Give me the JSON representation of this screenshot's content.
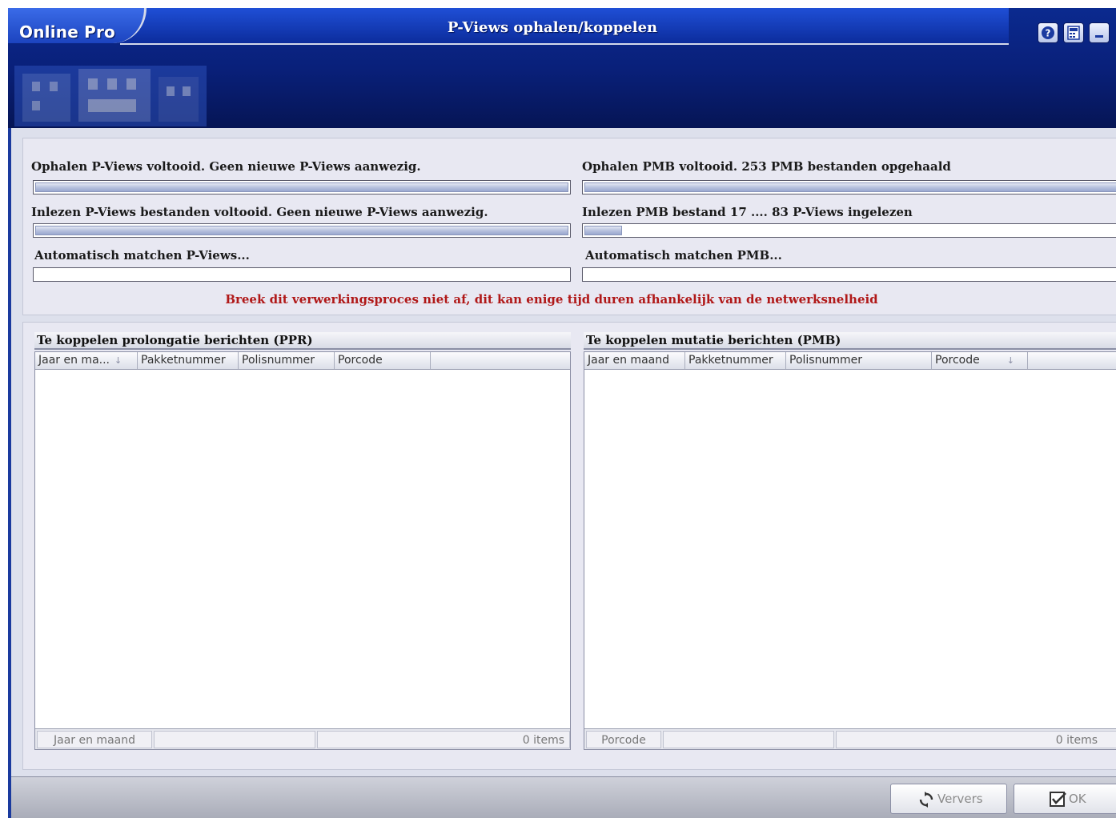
{
  "app": {
    "brand": "Online Pro",
    "title": "P-Views ophalen/koppelen"
  },
  "header_buttons": [
    "help-icon",
    "calculator-icon",
    "minimize-icon"
  ],
  "progress": {
    "pviews_fetch": {
      "label": "Ophalen P-Views voltooid. Geen nieuwe P-Views aanwezig.",
      "value": 1.0
    },
    "pviews_read": {
      "label": "Inlezen P-Views bestanden voltooid. Geen nieuwe P-Views aanwezig.",
      "value": 1.0
    },
    "pviews_match": {
      "label": "Automatisch matchen P-Views...",
      "value": 0.0
    },
    "pmb_fetch": {
      "label": "Ophalen PMB voltooid.  253 PMB bestanden opgehaald",
      "value": 1.0
    },
    "pmb_read": {
      "label": "Inlezen PMB bestand 17 .... 83 P-Views ingelezen",
      "value": 0.07
    },
    "pmb_match": {
      "label": "Automatisch matchen PMB...",
      "value": 0.0
    }
  },
  "warning": "Breek dit verwerkingsproces niet af, dit kan enige tijd duren afhankelijk van de netwerksnelheid",
  "ppr_list": {
    "title": "Te koppelen prolongatie berichten (PPR)",
    "columns": [
      "Jaar en ma...",
      "Pakketnummer",
      "Polisnummer",
      "Porcode"
    ],
    "rows": [],
    "footer_group": "Jaar en maand",
    "footer_count": "0 items"
  },
  "pmb_list": {
    "title": "Te koppelen mutatie berichten (PMB)",
    "columns": [
      "Jaar en maand",
      "Pakketnummer",
      "Polisnummer",
      "Porcode"
    ],
    "rows": [],
    "footer_group": "Porcode",
    "footer_count": "0 items"
  },
  "buttons": {
    "refresh": "Ververs",
    "ok": "OK"
  }
}
